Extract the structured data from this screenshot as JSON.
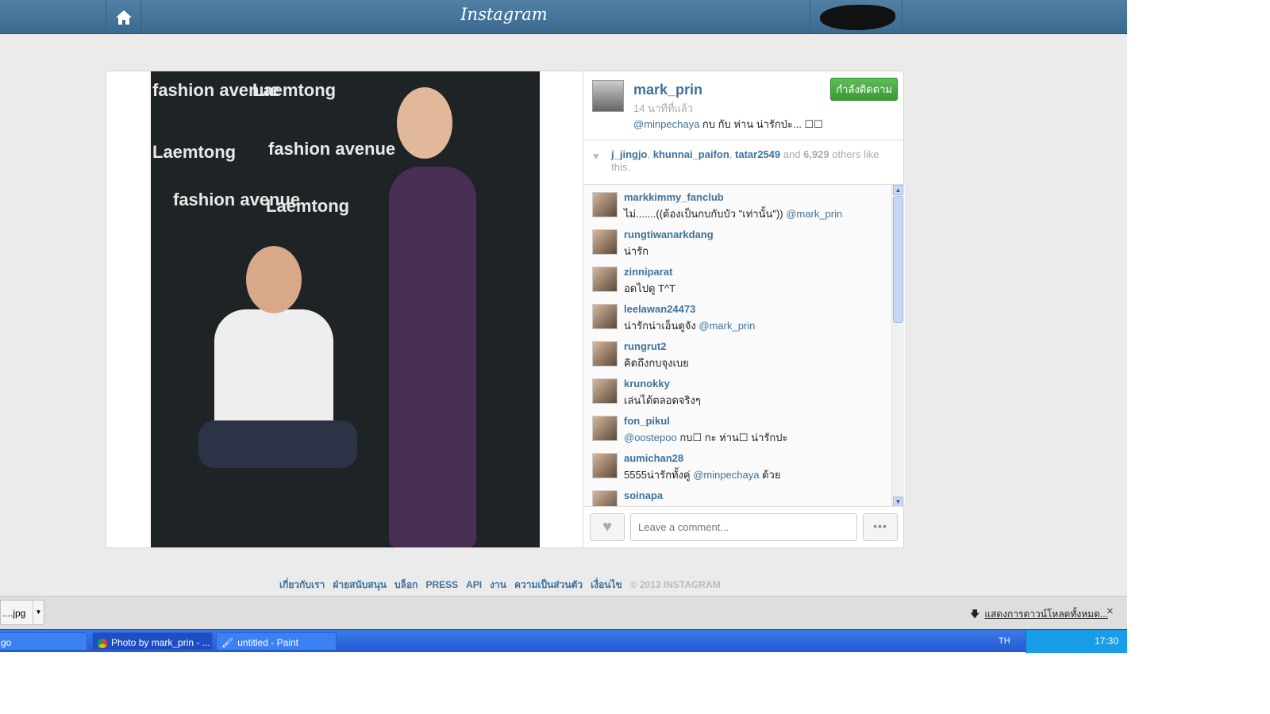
{
  "header": {
    "logo": "Instagram"
  },
  "post": {
    "username": "mark_prin",
    "time": "14 นาทีที่แล้ว",
    "follow_label": "กำลังติดตาม",
    "caption_mention": "@minpechaya",
    "caption_text": " กบ กับ ห่าน น่ารักป่ะ... ☐☐",
    "likers": [
      "j_jingjo",
      "khunnai_paifon",
      "tatar2549"
    ],
    "likes_and": " and ",
    "likes_count": "6,929",
    "likes_suffix": " others like this."
  },
  "photo": {
    "watermarks": [
      "fashion avenue",
      "Laemtong",
      "fashion avenue",
      "Laemtong",
      "fashion avenue",
      "Laemtong"
    ]
  },
  "comments": [
    {
      "user": "markkimmy_fanclub",
      "text": "ไม่.......((ต้องเป็นกบกับบัว \"เท่านั้น\")) ",
      "mention": "@mark_prin"
    },
    {
      "user": "rungtiwanarkdang",
      "text": "น่ารัก",
      "mention": ""
    },
    {
      "user": "zinniparat",
      "text": "อดไปดู T^T",
      "mention": ""
    },
    {
      "user": "leelawan24473",
      "text": "น่ารักน่าเอ็นดูจัง ",
      "mention": "@mark_prin"
    },
    {
      "user": "rungrut2",
      "text": "คิดถึงกบจุงเบย",
      "mention": ""
    },
    {
      "user": "krunokky",
      "text": "เล่นได้ตลอดจริงๆ",
      "mention": ""
    },
    {
      "user": "fon_pikul",
      "text": " กบ☐ กะ ห่าน☐ น่ารักปะ",
      "mention": "@oostepoo",
      "mention_first": true
    },
    {
      "user": "aumichan28",
      "text": "5555น่ารักทั้งคู่ ",
      "mention": "@minpechaya",
      "after": " ด้วย"
    },
    {
      "user": "soinapa",
      "text": "",
      "mention": ""
    }
  ],
  "comment_input": {
    "placeholder": "Leave a comment..."
  },
  "more_label": "•••",
  "footer": {
    "links": [
      "เกี่ยวกับเรา",
      "ฝ่ายสนับสนุน",
      "บล็อก",
      "PRESS",
      "API",
      "งาน",
      "ความเป็นส่วนตัว",
      "เงื่อนไข"
    ],
    "copyright": "© 2013 INSTAGRAM"
  },
  "downloads": {
    "item": "....jpg",
    "show_all": "แสดงการดาวน์โหลดทั้งหมด...",
    "close": "×"
  },
  "taskbar": {
    "items": [
      "go",
      "Photo by mark_prin - ...",
      "untitled - Paint"
    ],
    "lang": "TH",
    "clock": "17:30"
  }
}
